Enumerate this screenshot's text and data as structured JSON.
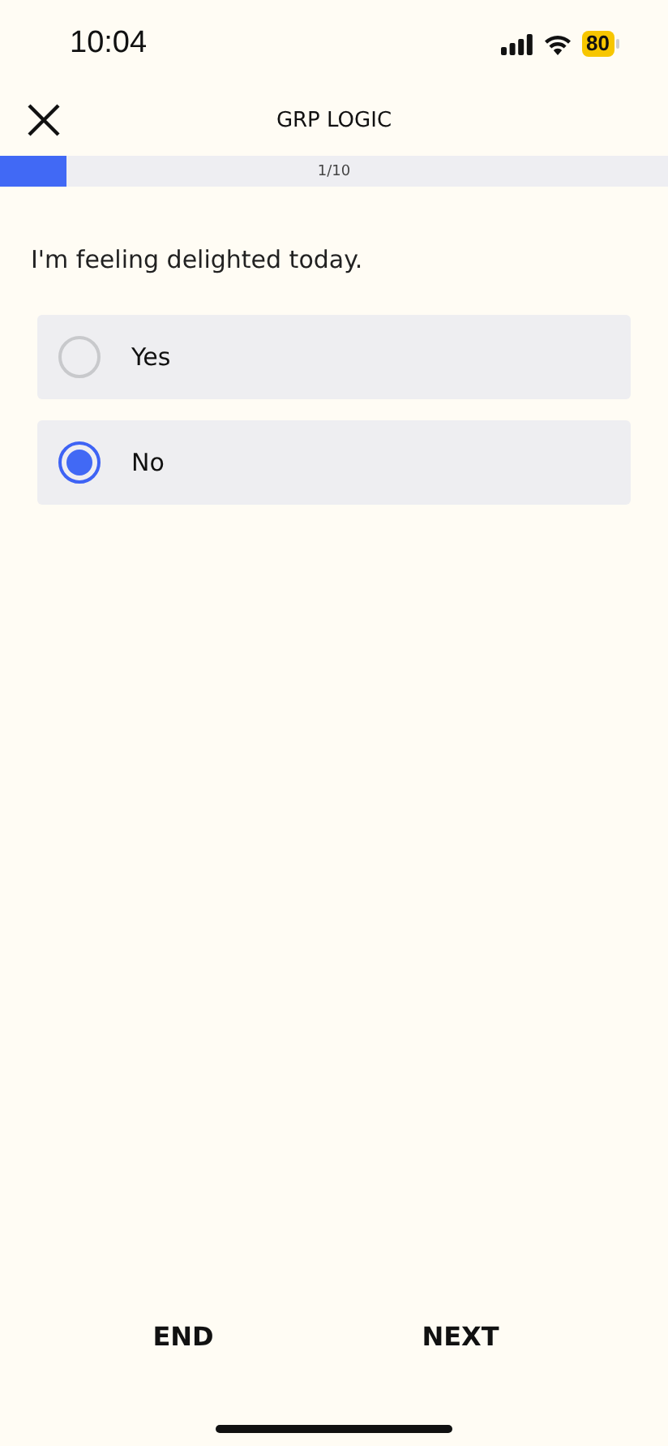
{
  "status_bar": {
    "time": "10:04",
    "battery": "80"
  },
  "header": {
    "title": "GRP LOGIC"
  },
  "progress": {
    "level": 0.1,
    "label": "1/10"
  },
  "question": "I'm feeling delighted today.",
  "options": [
    {
      "label": "Yes",
      "selected": false
    },
    {
      "label": "No",
      "selected": true
    }
  ],
  "buttons": [
    "END",
    "NEXT"
  ]
}
